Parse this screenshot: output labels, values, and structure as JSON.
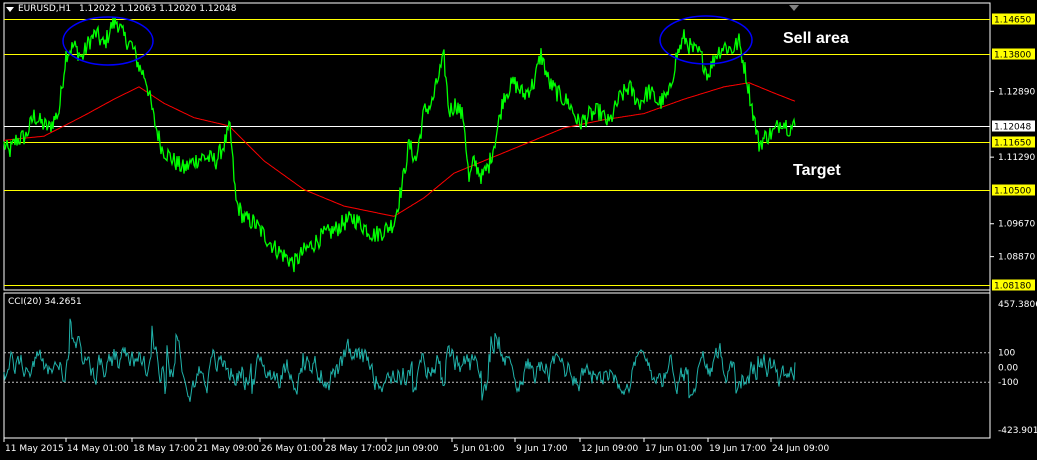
{
  "header": {
    "symbol": "EURUSD,H1",
    "ohlc": "1.12022 1.12063 1.12020 1.12048"
  },
  "cci_header": "CCI(20) 34.2651",
  "annotations": {
    "sell_area": "Sell area",
    "target": "Target"
  },
  "colors": {
    "background": "#000000",
    "price": "#00ff00",
    "ma": "#ff0000",
    "cci": "#20b2aa",
    "level_yellow": "#ffff00",
    "level_white": "#ffffff",
    "ellipse": "#0000ff"
  },
  "chart_data": [
    {
      "type": "line",
      "name": "main",
      "ylim": [
        1.0818,
        1.1465
      ],
      "price_ticks": [
        "1.12890",
        "1.11290",
        "1.09670",
        "1.08870"
      ],
      "price_tick_values": [
        1.1289,
        1.1129,
        1.0967,
        1.0887
      ],
      "levels": [
        {
          "label": "1.14650",
          "value": 1.1465,
          "color": "#ffff00"
        },
        {
          "label": "1.13800",
          "value": 1.138,
          "color": "#ffff00"
        },
        {
          "label": "1.12048",
          "value": 1.12048,
          "color": "#ffffff"
        },
        {
          "label": "1.11650",
          "value": 1.1165,
          "color": "#ffff00"
        },
        {
          "label": "1.10500",
          "value": 1.105,
          "color": "#ffff00"
        },
        {
          "label": "1.08180",
          "value": 1.0818,
          "color": "#ffff00"
        }
      ],
      "x_labels": [
        "11 May 2015",
        "14 May 01:00",
        "18 May 17:00",
        "21 May 09:00",
        "26 May 01:00",
        "28 May 17:00",
        "2 Jun 09:00",
        "5 Jun 01:00",
        "9 Jun 17:00",
        "12 Jun 09:00",
        "17 Jun 01:00",
        "19 Jun 17:00",
        "24 Jun 09:00"
      ],
      "price_anchors": [
        [
          0,
          1.116
        ],
        [
          5,
          1.114
        ],
        [
          12,
          1.117
        ],
        [
          22,
          1.118
        ],
        [
          30,
          1.123
        ],
        [
          38,
          1.121
        ],
        [
          45,
          1.12
        ],
        [
          55,
          1.124
        ],
        [
          62,
          1.138
        ],
        [
          70,
          1.14
        ],
        [
          78,
          1.137
        ],
        [
          85,
          1.141
        ],
        [
          92,
          1.143
        ],
        [
          100,
          1.14
        ],
        [
          108,
          1.145
        ],
        [
          113,
          1.146
        ],
        [
          120,
          1.142
        ],
        [
          128,
          1.14
        ],
        [
          135,
          1.135
        ],
        [
          142,
          1.132
        ],
        [
          150,
          1.122
        ],
        [
          158,
          1.115
        ],
        [
          170,
          1.112
        ],
        [
          180,
          1.11
        ],
        [
          190,
          1.112
        ],
        [
          200,
          1.113
        ],
        [
          212,
          1.112
        ],
        [
          220,
          1.116
        ],
        [
          226,
          1.12
        ],
        [
          232,
          1.102
        ],
        [
          240,
          1.098
        ],
        [
          250,
          1.097
        ],
        [
          260,
          1.094
        ],
        [
          270,
          1.091
        ],
        [
          280,
          1.089
        ],
        [
          290,
          1.087
        ],
        [
          300,
          1.09
        ],
        [
          310,
          1.092
        ],
        [
          320,
          1.094
        ],
        [
          330,
          1.095
        ],
        [
          340,
          1.097
        ],
        [
          350,
          1.098
        ],
        [
          360,
          1.096
        ],
        [
          370,
          1.094
        ],
        [
          380,
          1.095
        ],
        [
          390,
          1.097
        ],
        [
          398,
          1.106
        ],
        [
          405,
          1.116
        ],
        [
          412,
          1.112
        ],
        [
          420,
          1.124
        ],
        [
          428,
          1.126
        ],
        [
          435,
          1.133
        ],
        [
          440,
          1.137
        ],
        [
          445,
          1.124
        ],
        [
          452,
          1.126
        ],
        [
          460,
          1.122
        ],
        [
          465,
          1.107
        ],
        [
          470,
          1.112
        ],
        [
          478,
          1.108
        ],
        [
          485,
          1.111
        ],
        [
          492,
          1.118
        ],
        [
          500,
          1.128
        ],
        [
          510,
          1.131
        ],
        [
          520,
          1.128
        ],
        [
          530,
          1.131
        ],
        [
          537,
          1.138
        ],
        [
          545,
          1.131
        ],
        [
          555,
          1.128
        ],
        [
          565,
          1.126
        ],
        [
          575,
          1.121
        ],
        [
          585,
          1.123
        ],
        [
          595,
          1.124
        ],
        [
          605,
          1.121
        ],
        [
          615,
          1.127
        ],
        [
          625,
          1.13
        ],
        [
          635,
          1.126
        ],
        [
          645,
          1.129
        ],
        [
          655,
          1.126
        ],
        [
          665,
          1.128
        ],
        [
          672,
          1.137
        ],
        [
          680,
          1.142
        ],
        [
          688,
          1.139
        ],
        [
          696,
          1.138
        ],
        [
          704,
          1.133
        ],
        [
          712,
          1.138
        ],
        [
          720,
          1.14
        ],
        [
          728,
          1.139
        ],
        [
          735,
          1.141
        ],
        [
          742,
          1.133
        ],
        [
          748,
          1.125
        ],
        [
          755,
          1.116
        ],
        [
          762,
          1.118
        ],
        [
          770,
          1.119
        ],
        [
          778,
          1.122
        ],
        [
          785,
          1.12
        ],
        [
          791,
          1.1205
        ]
      ],
      "ma_anchors": [
        [
          0,
          1.117
        ],
        [
          40,
          1.118
        ],
        [
          80,
          1.123
        ],
        [
          110,
          1.127
        ],
        [
          135,
          1.13
        ],
        [
          160,
          1.126
        ],
        [
          190,
          1.1225
        ],
        [
          225,
          1.1205
        ],
        [
          260,
          1.112
        ],
        [
          300,
          1.105
        ],
        [
          340,
          1.101
        ],
        [
          370,
          1.0995
        ],
        [
          390,
          1.0985
        ],
        [
          420,
          1.103
        ],
        [
          450,
          1.109
        ],
        [
          480,
          1.112
        ],
        [
          520,
          1.116
        ],
        [
          560,
          1.12
        ],
        [
          600,
          1.122
        ],
        [
          640,
          1.1235
        ],
        [
          680,
          1.127
        ],
        [
          720,
          1.13
        ],
        [
          745,
          1.131
        ],
        [
          770,
          1.1285
        ],
        [
          791,
          1.1265
        ]
      ]
    },
    {
      "type": "line",
      "name": "cci",
      "ylim": [
        -423.901,
        457.3806
      ],
      "ticks": [
        "457.3806",
        "100",
        "0.00",
        "-100",
        "-423.901"
      ],
      "tick_values": [
        457.3806,
        100,
        0,
        -100,
        -423.901
      ],
      "dashed_levels": [
        100,
        -100
      ],
      "last_value": 34.2651
    }
  ]
}
